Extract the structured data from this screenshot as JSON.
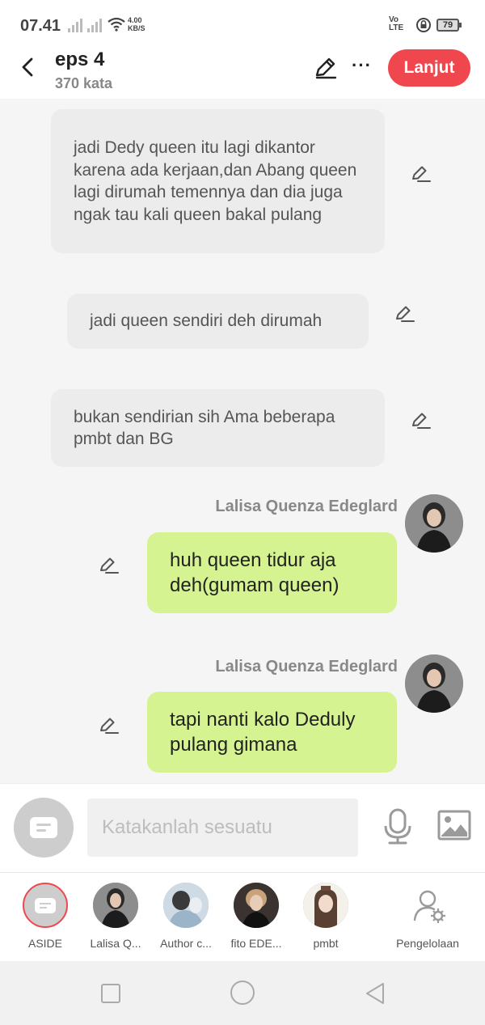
{
  "status_bar": {
    "time": "07.41",
    "speed_value": "4.00",
    "speed_unit": "KB/S",
    "network_top": "Vo",
    "network_bottom": "LTE",
    "battery": "79"
  },
  "header": {
    "title": "eps 4",
    "word_count": "370 kata",
    "next_label": "Lanjut",
    "more_label": "···"
  },
  "messages": [
    {
      "type": "aside",
      "text": "jadi Dedy queen itu lagi dikantor karena ada kerjaan,dan Abang queen lagi dirumah temennya dan dia juga ngak tau kali queen bakal pulang"
    },
    {
      "type": "aside",
      "text": "jadi queen sendiri deh dirumah"
    },
    {
      "type": "aside",
      "text": "bukan sendirian sih Ama beberapa pmbt dan BG"
    },
    {
      "type": "character",
      "speaker": "Lalisa Quenza Edeglard",
      "text": "huh queen tidur aja deh(gumam queen)"
    },
    {
      "type": "character",
      "speaker": "Lalisa Quenza Edeglard",
      "text": "tapi nanti kalo Deduly pulang gimana"
    }
  ],
  "composer": {
    "placeholder": "Katakanlah sesuatu"
  },
  "characters": [
    {
      "label": "ASIDE"
    },
    {
      "label": "Lalisa Q..."
    },
    {
      "label": "Author c..."
    },
    {
      "label": "fito EDE..."
    },
    {
      "label": "pmbt"
    },
    {
      "label": "Pengelolaan"
    }
  ],
  "colors": {
    "accent": "#f0474f",
    "character_bubble": "#d6f391",
    "aside_bubble": "#ececec",
    "chat_background": "#f5f5f5"
  }
}
